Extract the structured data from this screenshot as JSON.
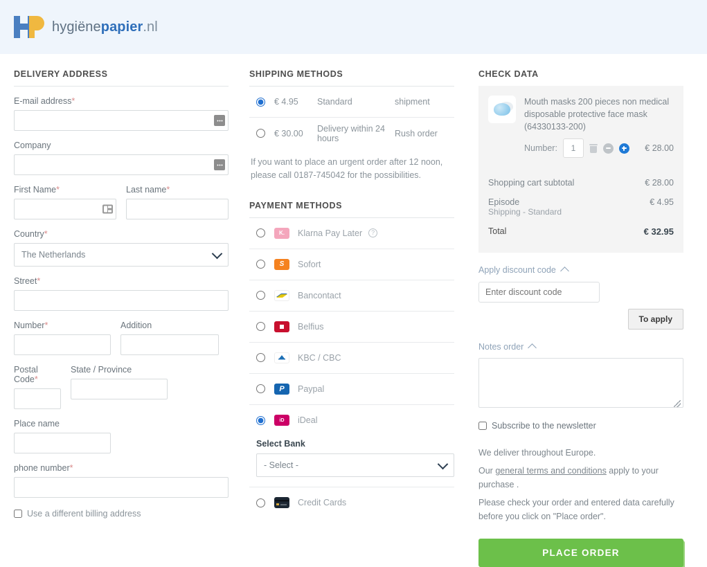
{
  "header": {
    "logo_text_1": "hygiëne",
    "logo_text_2": "papier",
    "logo_tld": ".nl"
  },
  "delivery": {
    "title": "DELIVERY ADDRESS",
    "email_label": "E-mail address",
    "company_label": "Company",
    "first_name_label": "First Name",
    "last_name_label": "Last name",
    "country_label": "Country",
    "country_value": "The Netherlands",
    "street_label": "Street",
    "number_label": "Number",
    "addition_label": "Addition",
    "postal_label": "Postal Code",
    "state_label": "State / Province",
    "place_label": "Place name",
    "phone_label": "phone number",
    "billing_checkbox": "Use a different billing address",
    "required_mark": "*"
  },
  "shipping": {
    "title": "SHIPPING METHODS",
    "options": [
      {
        "price": "€ 4.95",
        "name": "Standard",
        "tag": "shipment",
        "selected": true
      },
      {
        "price": "€ 30.00",
        "name": "Delivery within 24 hours",
        "tag": "Rush order",
        "selected": false
      }
    ],
    "note": "If you want to place an urgent order after 12 noon, please call 0187-745042 for the possibilities."
  },
  "payment": {
    "title": "PAYMENT METHODS",
    "methods": [
      {
        "name": "Klarna Pay Later",
        "icon": "klarna-icon",
        "selected": false,
        "has_help": true,
        "color": "#f4a6bc",
        "glyph": "K."
      },
      {
        "name": "Sofort",
        "icon": "sofort-icon",
        "selected": false,
        "has_help": false,
        "color": "#f58220",
        "glyph": "S"
      },
      {
        "name": "Bancontact",
        "icon": "bancontact-icon",
        "selected": false,
        "has_help": false,
        "color": "#ffffff",
        "glyph": ""
      },
      {
        "name": "Belfius",
        "icon": "belfius-icon",
        "selected": false,
        "has_help": false,
        "color": "#c8102e",
        "glyph": ""
      },
      {
        "name": "KBC / CBC",
        "icon": "kbc-icon",
        "selected": false,
        "has_help": false,
        "color": "#ffffff",
        "glyph": "KBC"
      },
      {
        "name": "Paypal",
        "icon": "paypal-icon",
        "selected": false,
        "has_help": false,
        "color": "#1565b0",
        "glyph": "P"
      },
      {
        "name": "iDeal",
        "icon": "ideal-icon",
        "selected": true,
        "has_help": false,
        "color": "#cc0066",
        "glyph": "iD"
      },
      {
        "name": "Credit Cards",
        "icon": "credit-cards-icon",
        "selected": false,
        "has_help": false,
        "color": "#1c2733",
        "glyph": ""
      }
    ],
    "bank_label": "Select Bank",
    "bank_value": "- Select -"
  },
  "summary": {
    "title": "CHECK DATA",
    "product_name": "Mouth masks 200 pieces non medical disposable protective face mask (64330133-200)",
    "qty_label": "Number:",
    "qty_value": "1",
    "item_price": "€ 28.00",
    "rows": [
      {
        "label": "Shopping cart subtotal",
        "sub": "",
        "amount": "€ 28.00"
      },
      {
        "label": "Episode",
        "sub": "Shipping - Standard",
        "amount": "€ 4.95"
      }
    ],
    "total_label": "Total",
    "total_amount": "€ 32.95",
    "discount_head": "Apply discount code",
    "discount_placeholder": "Enter discount code",
    "apply_button": "To apply",
    "notes_head": "Notes order",
    "newsletter": "Subscribe to the newsletter",
    "legal_1": "We deliver throughout Europe.",
    "legal_2_pre": "Our ",
    "legal_link": "general terms and conditions",
    "legal_2_post": " apply to your purchase .",
    "legal_3": "Please check your order and entered data carefully before you click on \"Place order\".",
    "place_order": "Place order"
  },
  "colors": {
    "header_bg": "#eff5fc",
    "brand_blue": "#2f6fba",
    "brand_yellow": "#f0b840",
    "accent_radio": "#1f6fd0",
    "cta_green": "#6cc04a",
    "cart_bg": "#f4f4f4"
  }
}
